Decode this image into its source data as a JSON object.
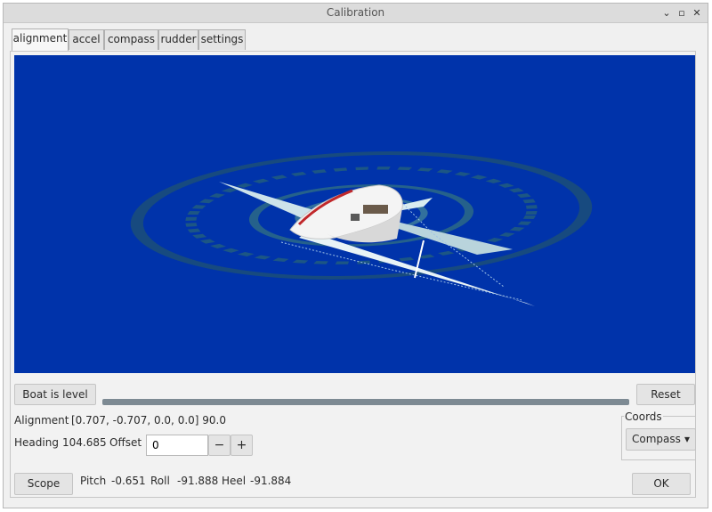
{
  "window": {
    "title": "Calibration",
    "controls": {
      "minimize": "⌄",
      "maximize": "▫",
      "close": "✕"
    }
  },
  "tabs": [
    {
      "label": "alignment",
      "active": true
    },
    {
      "label": "accel",
      "active": false
    },
    {
      "label": "compass",
      "active": false
    },
    {
      "label": "rudder",
      "active": false
    },
    {
      "label": "settings",
      "active": false
    }
  ],
  "viewport": {
    "background": "#0033aa",
    "content": "boat-3d-model"
  },
  "controls": {
    "boat_level_label": "Boat is level",
    "reset_label": "Reset",
    "level_progress": 0.0
  },
  "alignment": {
    "label": "Alignment",
    "value": "[0.707, -0.707, 0.0, 0.0] 90.0"
  },
  "heading": {
    "label": "Heading",
    "value": "104.685",
    "offset_label": "Offset",
    "offset_value": "0",
    "minus": "−",
    "plus": "+"
  },
  "coords": {
    "group_label": "Coords",
    "selected": "Compass",
    "chevron": "▾"
  },
  "status": {
    "scope_label": "Scope",
    "pitch_label": "Pitch",
    "pitch_value": "-0.651",
    "roll_label": "Roll",
    "roll_value": "-91.888",
    "heel_label": "Heel",
    "heel_value": "-91.884"
  },
  "ok_label": "OK"
}
